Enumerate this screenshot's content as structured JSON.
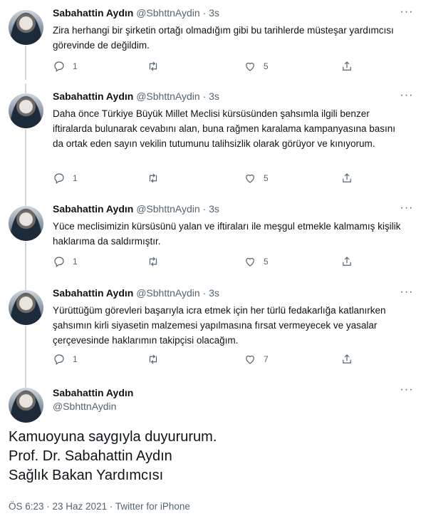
{
  "tweets": [
    {
      "name": "Sabahattin Aydın",
      "handle": "@SbhttnAydin",
      "time": "3s",
      "text": "Zira herhangi bir şirketin ortağı olmadığım gibi bu tarihlerde müsteşar yardımcısı görevinde de değildim.",
      "replies": "1",
      "likes": "5"
    },
    {
      "name": "Sabahattin Aydın",
      "handle": "@SbhttnAydin",
      "time": "3s",
      "text": "Daha önce Türkiye Büyük Millet Meclisi kürsüsünden şahsımla ilgili benzer iftiralarda bulunarak cevabını alan, buna rağmen karalama kampanyasına basını da ortak eden sayın vekilin tutumunu talihsizlik olarak görüyor ve kınıyorum.",
      "replies": "1",
      "likes": "5"
    },
    {
      "name": "Sabahattin Aydın",
      "handle": "@SbhttnAydin",
      "time": "3s",
      "text": "Yüce meclisimizin kürsüsünü yalan ve iftiraları ile meşgul etmekle kalmamış kişilik haklarıma da saldırmıştır.",
      "replies": "1",
      "likes": "5"
    },
    {
      "name": "Sabahattin Aydın",
      "handle": "@SbhttnAydin",
      "time": "3s",
      "text": "Yürüttüğüm görevleri başarıyla icra etmek için her türlü fedakarlığa katlanırken şahsımın kirli siyasetin malzemesi yapılmasına fırsat vermeyecek ve yasalar çerçevesinde haklarımın takipçisi olacağım.",
      "replies": "1",
      "likes": "7"
    }
  ],
  "main_tweet": {
    "name": "Sabahattin Aydın",
    "handle": "@SbhttnAydin",
    "lines": [
      "Kamuoyuna saygıyla duyururum.",
      "Prof. Dr. Sabahattin Aydın",
      "Sağlık Bakan Yardımcısı"
    ],
    "meta": "ÖS 6:23 · 23 Haz 2021 · Twitter for iPhone"
  },
  "icons": {
    "reply": "reply-icon",
    "retweet": "retweet-icon",
    "like": "like-icon",
    "share": "share-icon",
    "more": "more-icon"
  }
}
